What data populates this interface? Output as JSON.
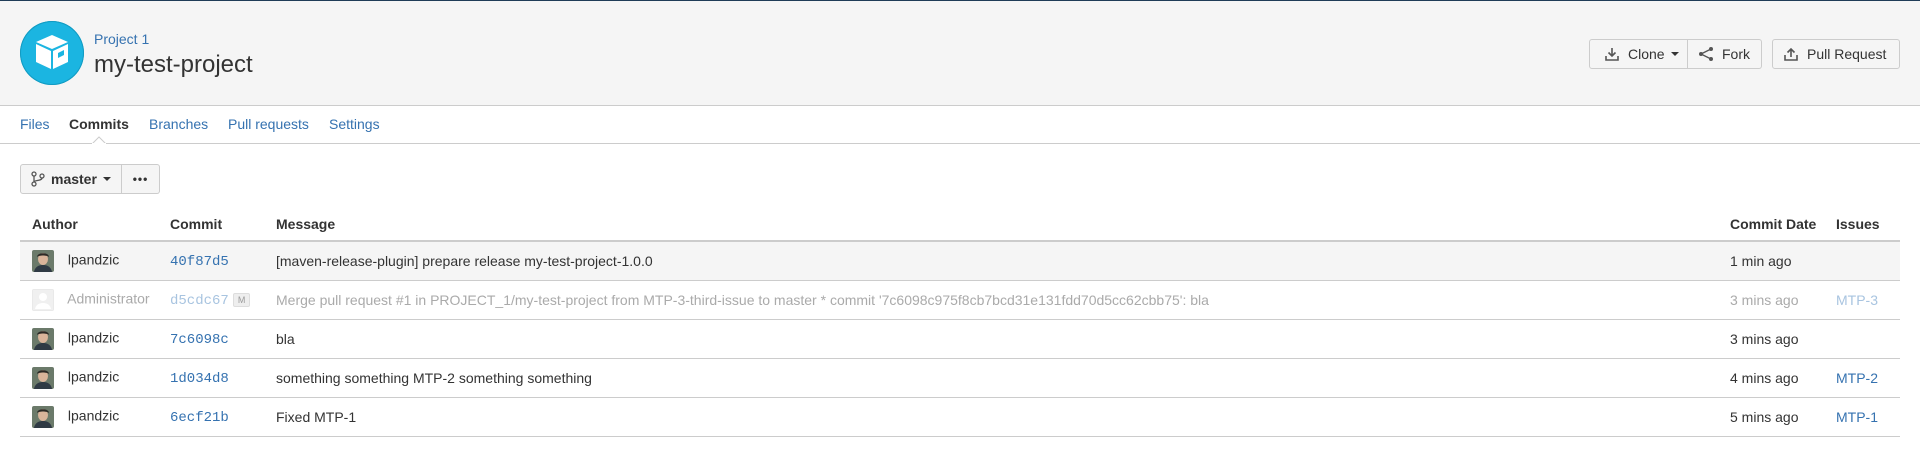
{
  "header": {
    "project_name": "Project 1",
    "repo_name": "my-test-project",
    "buttons": {
      "clone": "Clone",
      "fork": "Fork",
      "pull_request": "Pull Request"
    }
  },
  "tabs": [
    "Files",
    "Commits",
    "Branches",
    "Pull requests",
    "Settings"
  ],
  "active_tab": "Commits",
  "branch": {
    "name": "master",
    "more_label": "•••"
  },
  "table": {
    "columns": {
      "author": "Author",
      "commit": "Commit",
      "message": "Message",
      "date": "Commit Date",
      "issues": "Issues"
    },
    "rows": [
      {
        "author": "lpandzic",
        "hash": "40f87d5",
        "badge": "",
        "message": "[maven-release-plugin] prepare release my-test-project-1.0.0",
        "date": "1 min ago",
        "issue": ""
      },
      {
        "author": "Administrator",
        "hash": "d5cdc67",
        "badge": "M",
        "message": "Merge pull request #1 in PROJECT_1/my-test-project from MTP-3-third-issue to master * commit '7c6098c975f8cb7bcd31e131fdd70d5cc62cbb75': bla",
        "date": "3 mins ago",
        "issue": "MTP-3"
      },
      {
        "author": "lpandzic",
        "hash": "7c6098c",
        "badge": "",
        "message": "bla",
        "date": "3 mins ago",
        "issue": ""
      },
      {
        "author": "lpandzic",
        "hash": "1d034d8",
        "badge": "",
        "message": "something something MTP-2 something something",
        "date": "4 mins ago",
        "issue": "MTP-2"
      },
      {
        "author": "lpandzic",
        "hash": "6ecf21b",
        "badge": "",
        "message": "Fixed MTP-1",
        "date": "5 mins ago",
        "issue": "MTP-1"
      }
    ]
  },
  "colors": {
    "link": "#3572b0",
    "accent": "#1bb5e1",
    "header_bg": "#f5f5f5"
  }
}
